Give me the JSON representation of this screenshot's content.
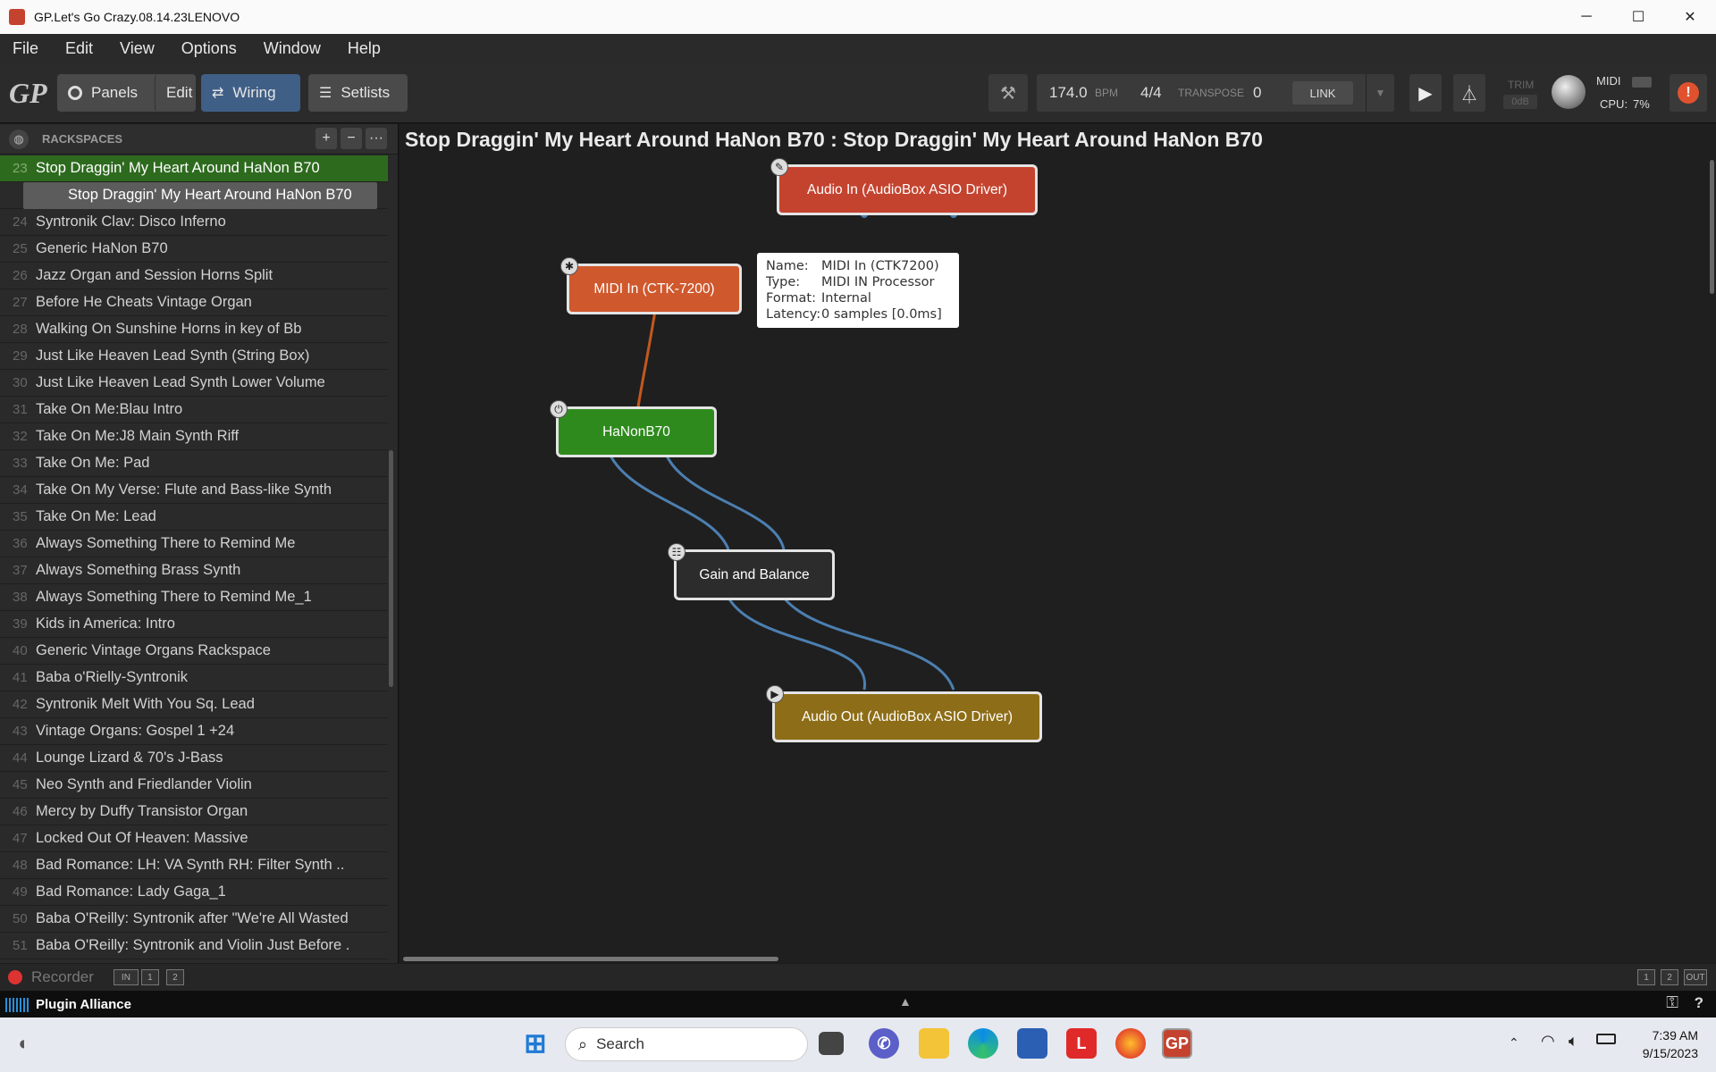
{
  "window": {
    "title": "GP.Let's Go Crazy.08.14.23LENOVO",
    "minimize": "─",
    "maximize": "☐",
    "close": "✕"
  },
  "menu": [
    "File",
    "Edit",
    "View",
    "Options",
    "Window",
    "Help"
  ],
  "toolbar": {
    "panels": "Panels",
    "edit": "Edit",
    "wiring": "Wiring",
    "setlists": "Setlists",
    "bpm_value": "174.0",
    "bpm_unit": "BPM",
    "time_signature": "4/4",
    "transpose_label": "TRANSPOSE",
    "transpose_value": "0",
    "link": "LINK",
    "trim_label": "TRIM",
    "trim_value": "0dB",
    "midi_label": "MIDI",
    "cpu_label": "CPU:",
    "cpu_value": "7%"
  },
  "sidebar": {
    "header": "RACKSPACES",
    "add": "+",
    "remove": "−",
    "more": "···",
    "selected": {
      "num": "23",
      "name": "Stop Draggin' My Heart Around HaNon B70"
    },
    "variation": "Stop Draggin' My Heart Around HaNon B70",
    "items": [
      {
        "num": "24",
        "name": "Syntronik Clav: Disco Inferno"
      },
      {
        "num": "25",
        "name": "Generic HaNon B70"
      },
      {
        "num": "26",
        "name": "Jazz Organ and Session Horns Split"
      },
      {
        "num": "27",
        "name": "Before He Cheats Vintage Organ"
      },
      {
        "num": "28",
        "name": "Walking On Sunshine Horns in key of Bb"
      },
      {
        "num": "29",
        "name": "Just Like Heaven Lead Synth (String Box)"
      },
      {
        "num": "30",
        "name": "Just Like Heaven Lead Synth Lower Volume"
      },
      {
        "num": "31",
        "name": "Take On Me:Blau Intro"
      },
      {
        "num": "32",
        "name": "Take On Me:J8 Main Synth Riff"
      },
      {
        "num": "33",
        "name": "Take On Me: Pad"
      },
      {
        "num": "34",
        "name": "Take On My Verse:  Flute and Bass-like Synth"
      },
      {
        "num": "35",
        "name": "Take On Me: Lead"
      },
      {
        "num": "36",
        "name": "Always Something There to Remind Me"
      },
      {
        "num": "37",
        "name": "Always Something Brass Synth"
      },
      {
        "num": "38",
        "name": "Always Something There to Remind Me_1"
      },
      {
        "num": "39",
        "name": "Kids in America: Intro"
      },
      {
        "num": "40",
        "name": "Generic Vintage Organs Rackspace"
      },
      {
        "num": "41",
        "name": "Baba o'Rielly-Syntronik"
      },
      {
        "num": "42",
        "name": "Syntronik Melt With You Sq. Lead"
      },
      {
        "num": "43",
        "name": "Vintage Organs: Gospel 1 +24"
      },
      {
        "num": "44",
        "name": "Lounge Lizard & 70's J-Bass"
      },
      {
        "num": "45",
        "name": "Neo Synth and Friedlander Violin"
      },
      {
        "num": "46",
        "name": "Mercy by Duffy Transistor Organ"
      },
      {
        "num": "47",
        "name": "Locked Out Of Heaven: Massive"
      },
      {
        "num": "48",
        "name": "Bad Romance:  LH: VA Synth RH: Filter Synth .."
      },
      {
        "num": "49",
        "name": "Bad Romance: Lady Gaga_1"
      },
      {
        "num": "50",
        "name": "Baba O'Reilly: Syntronik after \"We're All Wasted"
      },
      {
        "num": "51",
        "name": "Baba O'Reilly: Syntronik and Violin Just Before ."
      }
    ]
  },
  "workspace": {
    "title": "Stop Draggin' My Heart Around HaNon B70 : Stop Draggin' My Heart Around HaNon B70",
    "nodes": {
      "audio_in": "Audio In (AudioBox ASIO Driver)",
      "midi_in": "MIDI In (CTK-7200)",
      "hanon": "HaNonB70",
      "gain": "Gain and Balance",
      "audio_out": "Audio Out (AudioBox ASIO Driver)"
    },
    "tooltip": {
      "name_k": "Name:",
      "name_v": "MIDI In (CTK7200)",
      "type_k": "Type:",
      "type_v": "MIDI IN Processor",
      "format_k": "Format:",
      "format_v": "Internal",
      "latency_k": "Latency:",
      "latency_v": "0 samples [0.0ms]"
    }
  },
  "recorder": {
    "label": "Recorder",
    "in": "IN",
    "ch1": "1",
    "ch2": "2",
    "out1": "1",
    "out2": "2",
    "out": "OUT"
  },
  "pluginbar": {
    "brand": "Plugin Alliance",
    "help": "?"
  },
  "taskbar": {
    "search_placeholder": "Search",
    "time": "7:39 AM",
    "date": "9/15/2023"
  },
  "colors": {
    "audio_in": "#c4432f",
    "midi_in": "#d0582d",
    "hanon": "#2f8a1e",
    "gain": "#2c2c2c",
    "audio_out": "#8d6d17",
    "wire_audio": "#4c7fb0",
    "wire_midi": "#c2581f",
    "selected_rack": "#2d6a1e"
  }
}
